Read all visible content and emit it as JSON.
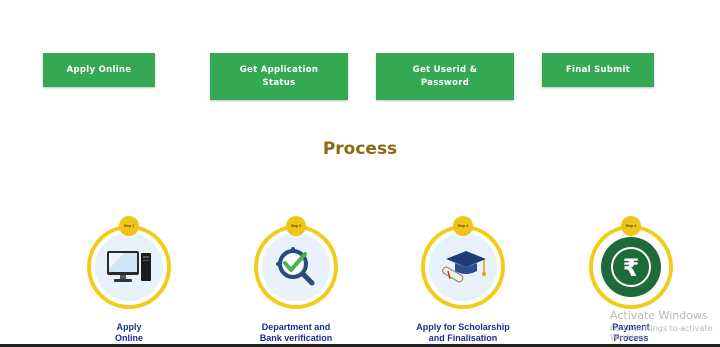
{
  "buttons": [
    {
      "label": "Apply Online"
    },
    {
      "label": "Get Application\nStatus"
    },
    {
      "label": "Get Userid &\nPassword"
    },
    {
      "label": "Final Submit"
    }
  ],
  "process_title": "Process",
  "steps": [
    {
      "badge": "Step 1",
      "icon": "computer-icon",
      "line1": "Apply",
      "line2": "Online"
    },
    {
      "badge": "Step 2",
      "icon": "verification-check-icon",
      "line1": "Department and",
      "line2": "Bank verification"
    },
    {
      "badge": "Step 3",
      "icon": "graduation-cap-icon",
      "line1": "Apply for Scholarship",
      "line2": "and Finalisation"
    },
    {
      "badge": "Step 4",
      "icon": "rupee-icon",
      "line1": "Payment",
      "line2": "Process"
    }
  ],
  "watermark": {
    "line1": "Activate Windows",
    "line2": "Go to Settings to activate Windows."
  },
  "colors": {
    "button": "#34a853",
    "title": "#8b6a12",
    "ring": "#f2cc1b",
    "label": "#1a2f8c"
  }
}
